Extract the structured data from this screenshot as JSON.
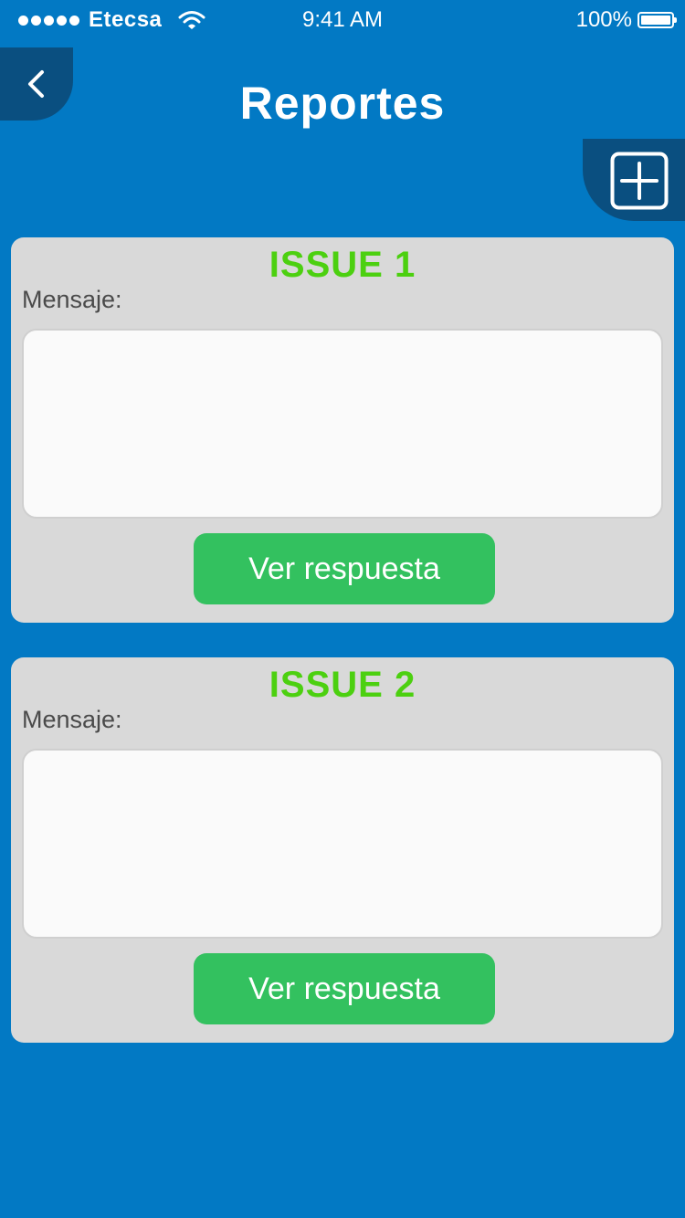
{
  "status_bar": {
    "carrier": "Etecsa",
    "time": "9:41 AM",
    "battery": "100%",
    "signal_icon": "signal-dots-icon",
    "wifi_icon": "wifi-icon",
    "battery_icon": "battery-icon"
  },
  "header": {
    "title": "Reportes",
    "back_icon": "chevron-left-icon",
    "add_icon": "plus-square-icon"
  },
  "issues": [
    {
      "title": "ISSUE 1",
      "message_label": "Mensaje:",
      "message": "",
      "button_label": "Ver respuesta"
    },
    {
      "title": "ISSUE 2",
      "message_label": "Mensaje:",
      "message": "",
      "button_label": "Ver respuesta"
    }
  ],
  "colors": {
    "background": "#0279C4",
    "header_tab": "#0A4F80",
    "card": "#D9D9D9",
    "issue_title": "#4CD010",
    "button": "#33C15F"
  }
}
